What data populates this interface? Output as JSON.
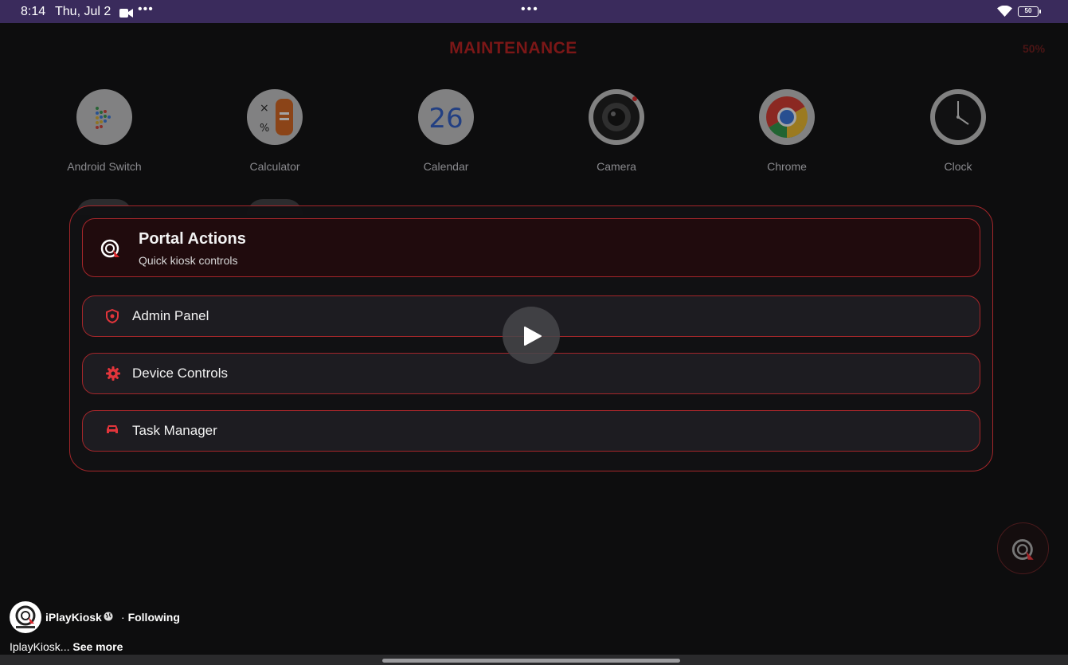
{
  "status_bar": {
    "time": "8:14",
    "date": "Thu, Jul 2",
    "more": "•••",
    "center_dots": "•••",
    "battery": "50"
  },
  "screen": {
    "title": "MAINTENANCE",
    "percent": "50%"
  },
  "apps": [
    {
      "label": "Android Switch",
      "icon": "android-switch-icon"
    },
    {
      "label": "Calculator",
      "icon": "calculator-icon"
    },
    {
      "label": "Calendar",
      "icon": "calendar-icon",
      "day": "26"
    },
    {
      "label": "Camera",
      "icon": "camera-icon"
    },
    {
      "label": "Chrome",
      "icon": "chrome-icon"
    },
    {
      "label": "Clock",
      "icon": "clock-icon"
    }
  ],
  "portal": {
    "title": "Portal Actions",
    "subtitle": "Quick kiosk controls",
    "items": [
      {
        "label": "Admin Panel",
        "icon": "shield-icon"
      },
      {
        "label": "Device Controls",
        "icon": "gear-icon"
      },
      {
        "label": "Task Manager",
        "icon": "car-icon"
      }
    ]
  },
  "post": {
    "author": "iPlayKiosk",
    "separator": "·",
    "follow_label": "Following",
    "caption": "IplayKiosk...",
    "see_more": "See more"
  },
  "colors": {
    "accent": "#a3262a",
    "status_bar": "#3a2b5c",
    "background": "#0d0d0e"
  }
}
